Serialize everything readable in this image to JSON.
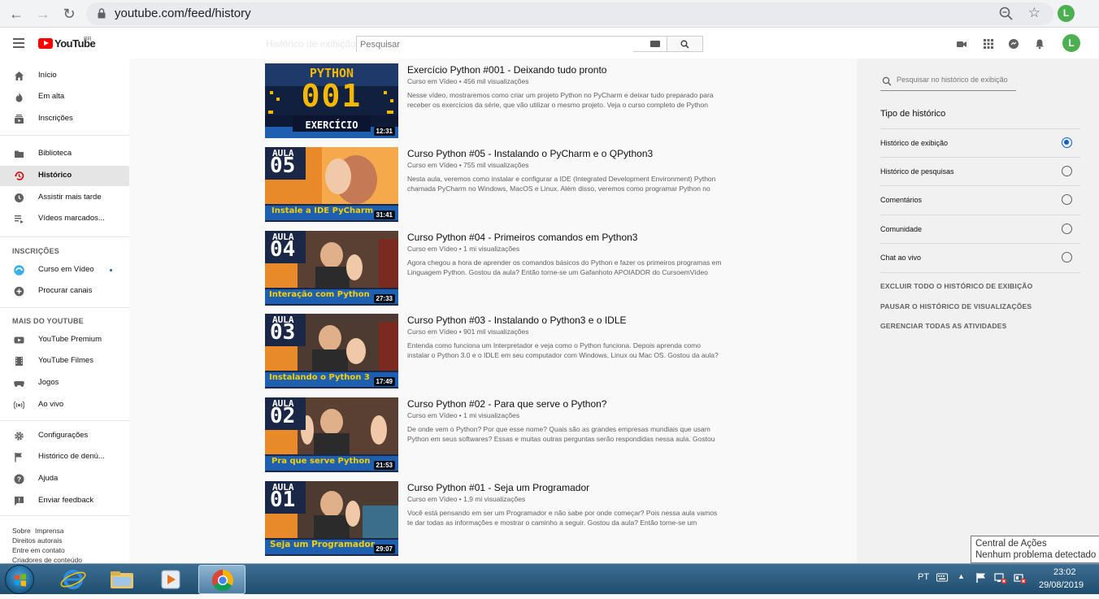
{
  "browser": {
    "url": "youtube.com/feed/history",
    "profile_initial": "L"
  },
  "youtube": {
    "logo_text": "YouTube",
    "logo_region": "BR",
    "page_heading": "Histórico de exibição",
    "search_placeholder": "Pesquisar",
    "avatar_initial": "L"
  },
  "sidebar": {
    "items": [
      {
        "label": "Início",
        "icon": "home-icon"
      },
      {
        "label": "Em alta",
        "icon": "flame-icon"
      },
      {
        "label": "Inscrições",
        "icon": "subscriptions-icon"
      },
      {
        "label": "Biblioteca",
        "icon": "folder-icon"
      },
      {
        "label": "Histórico",
        "icon": "history-icon",
        "active": true
      },
      {
        "label": "Assistir mais tarde",
        "icon": "clock-icon"
      },
      {
        "label": "Vídeos marcados...",
        "icon": "playlist-icon"
      }
    ],
    "subs_title": "INSCRIÇÕES",
    "subs": [
      {
        "label": "Curso em Vídeo",
        "icon": "channel-avatar-icon"
      },
      {
        "label": "Procurar canais",
        "icon": "add-circle-icon"
      }
    ],
    "more_title": "MAIS DO YOUTUBE",
    "more": [
      {
        "label": "YouTube Premium",
        "icon": "youtube-icon"
      },
      {
        "label": "YouTube Filmes",
        "icon": "film-icon"
      },
      {
        "label": "Jogos",
        "icon": "gamepad-icon"
      },
      {
        "label": "Ao vivo",
        "icon": "live-icon"
      }
    ],
    "settings": [
      {
        "label": "Configurações",
        "icon": "gear-icon"
      },
      {
        "label": "Histórico de denú...",
        "icon": "flag-icon"
      },
      {
        "label": "Ajuda",
        "icon": "help-icon"
      },
      {
        "label": "Enviar feedback",
        "icon": "feedback-icon"
      }
    ],
    "footer": [
      "Sobre",
      "Imprensa",
      "Direitos autorais",
      "Entre em contato",
      "Criadores de conteúdo"
    ]
  },
  "videos": [
    {
      "title": "Exercício Python #001 - Deixando tudo pronto",
      "channel": "Curso em Vídeo",
      "views": "456 mil visualizações",
      "desc": "Nesse vídeo, mostraremos como criar um projeto Python no PyCharm e deixar tudo preparado para receber os exercícios da série, que vão utilizar o mesmo projeto. Veja o curso completo de Python",
      "duration": "12:31",
      "thumb_top": "PYTHON",
      "thumb_num": "001",
      "thumb_bottom": "EXERCÍCIO"
    },
    {
      "title": "Curso Python #05 - Instalando o PyCharm e o QPython3",
      "channel": "Curso em Vídeo",
      "views": "755 mil visualizações",
      "desc": "Nesta aula, veremos como instalar e configurar a IDE (Integrated Development Environment) Python chamada PyCharm no Windows, MacOS e Linux. Além disso, veremos como programar Python no",
      "duration": "31:41",
      "thumb_top": "AULA",
      "thumb_num": "05",
      "thumb_bottom": "Instale a IDE PyCharm"
    },
    {
      "title": "Curso Python #04 - Primeiros comandos em Python3",
      "channel": "Curso em Vídeo",
      "views": "1 mi visualizações",
      "desc": "Agora chegou a hora de aprender os comandos básicos do Python e fazer os primeiros programas em Linguagem Python. Gostou da aula? Então torne-se um Gafanhoto APOIADOR do CursoemVídeo",
      "duration": "27:33",
      "thumb_top": "AULA",
      "thumb_num": "04",
      "thumb_bottom": "Interação com Python"
    },
    {
      "title": "Curso Python #03 - Instalando o Python3 e o IDLE",
      "channel": "Curso em Vídeo",
      "views": "901 mil visualizações",
      "desc": "Entenda como funciona um Interpretador e veja como o Python funciona. Depois aprenda como instalar o Python 3.0 e o IDLE em seu computador com Windows, Linux ou Mac OS. Gostou da aula?",
      "duration": "17:49",
      "thumb_top": "AULA",
      "thumb_num": "03",
      "thumb_bottom": "Instalando o Python 3"
    },
    {
      "title": "Curso Python #02 - Para que serve o Python?",
      "channel": "Curso em Vídeo",
      "views": "1 mi visualizações",
      "desc": "De onde vem o Python? Por que esse nome? Quais são as grandes empresas mundiais que usam Python em seus softwares? Essas e muitas outras perguntas serão respondidas nessa aula. Gostou",
      "duration": "21:53",
      "thumb_top": "AULA",
      "thumb_num": "02",
      "thumb_bottom": "Pra que serve Python"
    },
    {
      "title": "Curso Python #01 - Seja um Programador",
      "channel": "Curso em Vídeo",
      "views": "1,9 mi visualizações",
      "desc": "Você está pensando em ser um Programador e não sabe por onde começar? Pois nessa aula vamos te dar todas as informações e mostrar o caminho a seguir. Gostou da aula? Então torne-se um",
      "duration": "29:07",
      "thumb_top": "AULA",
      "thumb_num": "01",
      "thumb_bottom": "Seja um Programador"
    }
  ],
  "right_panel": {
    "search_placeholder": "Pesquisar no histórico de exibição",
    "type_title": "Tipo de histórico",
    "options": [
      {
        "label": "Histórico de exibição",
        "selected": true
      },
      {
        "label": "Histórico de pesquisas",
        "selected": false
      },
      {
        "label": "Comentários",
        "selected": false
      },
      {
        "label": "Comunidade",
        "selected": false
      },
      {
        "label": "Chat ao vivo",
        "selected": false
      }
    ],
    "actions": [
      "EXCLUIR TODO O HISTÓRICO DE EXIBIÇÃO",
      "PAUSAR O HISTÓRICO DE VISUALIZAÇÕES",
      "GERENCIAR TODAS AS ATIVIDADES"
    ]
  },
  "tooltip": {
    "line1": "Central de Ações",
    "line2": "Nenhum problema detectado"
  },
  "taskbar": {
    "lang": "PT",
    "time": "23:02",
    "date": "29/08/2019"
  },
  "colors": {
    "accent": "#065fd4",
    "youtube_red": "#ff0000",
    "thumb_yellow": "#f5b800",
    "thumb_navy": "#1a2746"
  }
}
